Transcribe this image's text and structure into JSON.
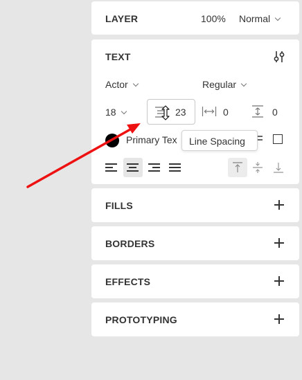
{
  "layer": {
    "title": "LAYER",
    "opacity": "100%",
    "blend_mode": "Normal"
  },
  "text": {
    "title": "TEXT",
    "font_family": "Actor",
    "font_weight": "Regular",
    "font_size": "18",
    "line_height": "23",
    "letter_spacing": "0",
    "paragraph_spacing": "0",
    "color_name": "Primary Tex",
    "color": "#000000",
    "tooltip": "Line Spacing"
  },
  "sections": {
    "fills": "FILLS",
    "borders": "BORDERS",
    "effects": "EFFECTS",
    "prototyping": "PROTOTYPING"
  },
  "annotation": {
    "arrow_color": "#ee1111"
  },
  "icons": [
    "sliders-icon",
    "line-height-icon",
    "letter-spacing-icon",
    "paragraph-spacing-icon",
    "align-left-icon",
    "align-center-icon",
    "align-right-icon",
    "align-justify-icon",
    "valign-top-icon",
    "valign-middle-icon",
    "valign-bottom-icon",
    "plus-icon",
    "resize-cursor-icon",
    "arrow-icon"
  ]
}
